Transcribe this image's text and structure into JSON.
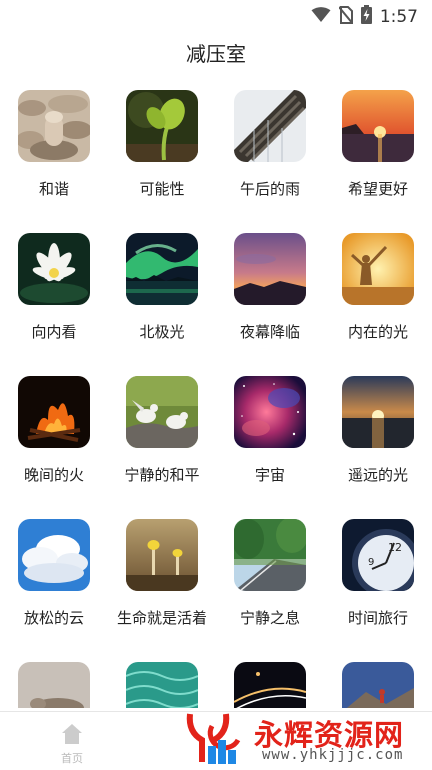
{
  "status": {
    "time": "1:57"
  },
  "page_title": "减压室",
  "items": [
    {
      "label": "和谐",
      "icon": "zen-stones-image"
    },
    {
      "label": "可能性",
      "icon": "sprout-image"
    },
    {
      "label": "午后的雨",
      "icon": "rain-roof-image"
    },
    {
      "label": "希望更好",
      "icon": "sunset-sea-image"
    },
    {
      "label": "向内看",
      "icon": "lotus-image"
    },
    {
      "label": "北极光",
      "icon": "aurora-image"
    },
    {
      "label": "夜幕降临",
      "icon": "dusk-sky-image"
    },
    {
      "label": "内在的光",
      "icon": "sunrise-person-image"
    },
    {
      "label": "晚间的火",
      "icon": "campfire-image"
    },
    {
      "label": "宁静的和平",
      "icon": "doves-image"
    },
    {
      "label": "宇宙",
      "icon": "nebula-image"
    },
    {
      "label": "遥远的光",
      "icon": "horizon-sun-image"
    },
    {
      "label": "放松的云",
      "icon": "clouds-image"
    },
    {
      "label": "生命就是活着",
      "icon": "mushrooms-image"
    },
    {
      "label": "宁静之息",
      "icon": "road-trees-image"
    },
    {
      "label": "时间旅行",
      "icon": "clock-image"
    },
    {
      "label": "",
      "icon": "sleeping-cat-image"
    },
    {
      "label": "",
      "icon": "water-ripple-image"
    },
    {
      "label": "",
      "icon": "night-traffic-image"
    },
    {
      "label": "",
      "icon": "mountain-climber-image"
    }
  ],
  "tabbar": {
    "home_label": "首页"
  },
  "watermark": {
    "title": "永辉资源网",
    "url": "www.yhkjjjc.com"
  },
  "colors": {
    "accent": "#e2231a",
    "tab_inactive": "#bbbbbb"
  }
}
